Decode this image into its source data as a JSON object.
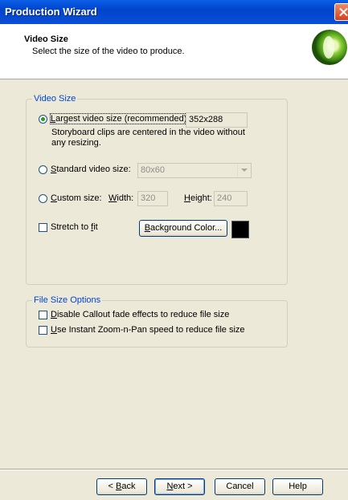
{
  "window": {
    "title": "Production Wizard",
    "close_icon": "close-icon"
  },
  "header": {
    "title": "Video Size",
    "subtitle": "Select the size of the video to produce.",
    "logo_icon": "camtasia-logo-icon"
  },
  "video_size": {
    "legend": "Video Size",
    "largest": {
      "label_u": "L",
      "label_rest": "argest video size (recommended)",
      "value": "352x288",
      "checked": true,
      "note_line1": "Storyboard clips are centered in the video without",
      "note_line2": "any resizing."
    },
    "standard": {
      "label_u": "S",
      "label_rest": "tandard video size:",
      "selected": "80x60",
      "checked": false
    },
    "custom": {
      "label_u": "C",
      "label_rest": "ustom size:",
      "width_label_u": "W",
      "width_label_rest": "idth:",
      "width_value": "320",
      "height_label_u": "H",
      "height_label_rest": "eight:",
      "height_value": "240",
      "checked": false
    },
    "stretch": {
      "label_pre": "Stretch to ",
      "label_u": "f",
      "label_rest": "it",
      "checked": false
    },
    "bg_button": {
      "label_u": "B",
      "label_rest": "ackground Color..."
    },
    "bg_color": "#000000"
  },
  "file_size": {
    "legend": "File Size Options",
    "disable_callout": {
      "label_u": "D",
      "label_rest": "isable Callout fade effects to reduce file size",
      "checked": false
    },
    "instant_zoom": {
      "label_u": "U",
      "label_rest": "se Instant Zoom-n-Pan speed to reduce file size",
      "checked": false
    }
  },
  "footer": {
    "back_label_pre": "< ",
    "back_label_u": "B",
    "back_label_rest": "ack",
    "next_label_u": "N",
    "next_label_rest": "ext >",
    "cancel_label": "Cancel",
    "help_label": "Help"
  }
}
